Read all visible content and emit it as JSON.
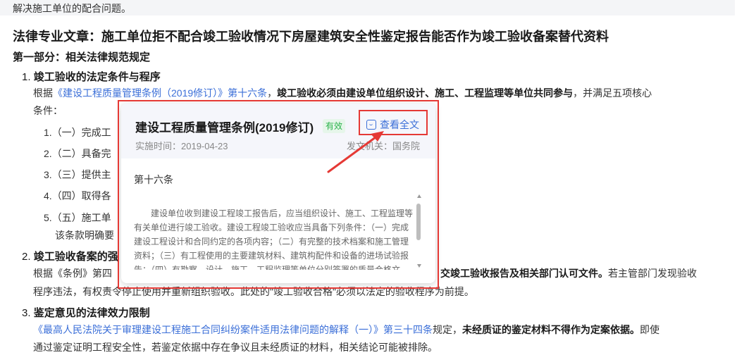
{
  "top_text": "解决施工单位的配合问题。",
  "article_title": "法律专业文章：施工单位拒不配合竣工验收情况下房屋建筑安全性鉴定报告能否作为竣工验收备案替代资料",
  "part1_title": "第一部分：相关法律规范规定",
  "section1": {
    "num": "1.",
    "title": "竣工验收的法定条件与程序",
    "line1_prefix": "根据",
    "line1_link": "《建设工程质量管理条例（2019修订）》第十六条",
    "line1_comma": "，",
    "line1_bold": "竣工验收必须由建设单位组织设计、施工、工程监理等单位共同参与",
    "line1_suffix": "，并满足五项核心",
    "line2": "条件：",
    "items": [
      "1.（一）完成工",
      "2.（二）具备完",
      "3.（三）提供主",
      "4.（四）取得各",
      "5.（五）施工单"
    ],
    "note": "该条款明确要"
  },
  "section2": {
    "num": "2.",
    "title": "竣工验收备案的强",
    "line1_prefix": "根据《条例》第四",
    "line1_bold": "交竣工验收报告及相关部门认可文件。",
    "line1_suffix": "若主管部门发现验收",
    "line2": "程序违法，有权责令停止使用并重新组织验收。此处的\"竣工验收合格\"必须以法定的验收程序为前提。"
  },
  "section3": {
    "num": "3.",
    "title": "鉴定意见的法律效力限制",
    "line1_link": "《最高人民法院关于审理建设工程施工合同纠纷案件适用法律问题的解释（一）》第三十四条",
    "line1_mid": "规定，",
    "line1_bold": "未经质证的鉴定材料不得作为定案依据。",
    "line1_suffix": "即使",
    "line2": "通过鉴定证明工程安全性，若鉴定依据中存在争议且未经质证的材料，相关结论可能被排除。"
  },
  "popup": {
    "title": "建设工程质量管理条例(2019修订)",
    "badge": "有效",
    "view_full": "查看全文",
    "date": "实施时间：2019-04-23",
    "issuer": "发文机关：国务院",
    "article": "第十六条",
    "text": "建设单位收到建设工程竣工报告后，应当组织设计、施工、工程监理等有关单位进行竣工验收。建设工程竣工验收应当具备下列条件：（一）完成建设工程设计和合同约定的各项内容；（二）有完整的技术档案和施工管理资料；（三）有工程使用的主要建筑材料、建筑构配件和设备的进场试验报告；（四）有勘察、设计、施工、工程监理等单位分别签署的质量合格文件；"
  },
  "colors": {
    "link": "#3b6fd8",
    "badge": "#2bb34b",
    "annotation": "#e53935"
  }
}
